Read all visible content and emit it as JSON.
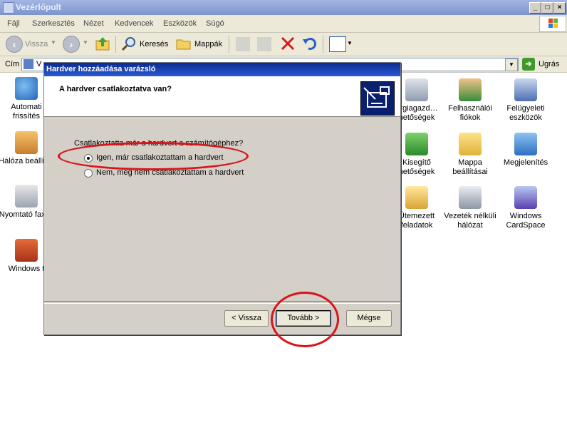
{
  "window": {
    "title": "Vezérlőpult"
  },
  "menubar": {
    "items": [
      "Fájl",
      "Szerkesztés",
      "Nézet",
      "Kedvencek",
      "Eszközök",
      "Súgó"
    ]
  },
  "toolbar": {
    "back_label": "Vissza",
    "search_label": "Keresés",
    "folders_label": "Mappák"
  },
  "addressbar": {
    "label": "Cím",
    "value": "V",
    "go_label": "Ugrás"
  },
  "icons_left": [
    {
      "label": "Automati frissítés",
      "icon": "shield-globe-icon"
    },
    {
      "label": "Hálóza beállít…",
      "icon": "network-house-icon"
    },
    {
      "label": "Nyomtató faxok",
      "icon": "printer-icon"
    },
    {
      "label": "Windows t",
      "icon": "firewall-icon"
    }
  ],
  "icons_right": [
    {
      "label": "ergiagazd… hetőségek",
      "icon": "power-plug-icon"
    },
    {
      "label": "Felhasználói fiókok",
      "icon": "users-icon"
    },
    {
      "label": "Felügyeleti eszközök",
      "icon": "admin-tools-icon"
    },
    {
      "label": "Kisegítő hetőségek",
      "icon": "accessibility-icon"
    },
    {
      "label": "Mappa beállításai",
      "icon": "folder-options-icon"
    },
    {
      "label": "Megjelenítés",
      "icon": "display-icon"
    },
    {
      "label": "Ütemezett feladatok",
      "icon": "scheduled-tasks-icon"
    },
    {
      "label": "Vezeték nélküli hálózat",
      "icon": "wireless-icon"
    },
    {
      "label": "Windows CardSpace",
      "icon": "cardspace-icon"
    }
  ],
  "dialog": {
    "title": "Hardver hozzáadása varázsló",
    "heading": "A hardver csatlakoztatva van?",
    "question": "Csatlakoztatta már a hardvert a számítógéphez?",
    "options": [
      {
        "label": "Igen, már csatlakoztattam a hardvert",
        "selected": true
      },
      {
        "label": "Nem, még nem csatlakoztattam a hardvert",
        "selected": false
      }
    ],
    "buttons": {
      "back": "< Vissza",
      "next": "Tovább >",
      "cancel": "Mégse"
    }
  },
  "colors": {
    "highlight_ring": "#d8151b",
    "dialog_title": "#0a2a8f"
  }
}
